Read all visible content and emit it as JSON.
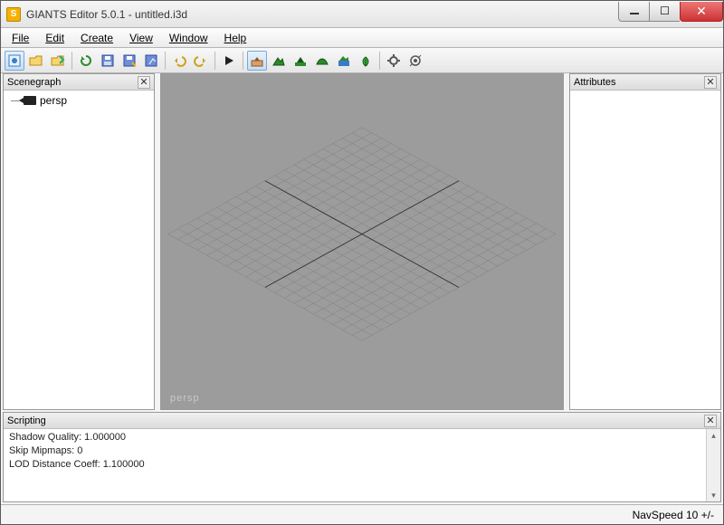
{
  "app": {
    "icon_letter": "S",
    "title": "GIANTS Editor 5.0.1 - untitled.i3d"
  },
  "menu": {
    "file": "File",
    "edit": "Edit",
    "create": "Create",
    "view": "View",
    "window": "Window",
    "help": "Help"
  },
  "panels": {
    "scenegraph": "Scenegraph",
    "attributes": "Attributes",
    "scripting": "Scripting"
  },
  "scenegraph": {
    "items": [
      {
        "label": "persp"
      }
    ]
  },
  "viewport": {
    "camera_label": "persp"
  },
  "scripting": {
    "lines": {
      "l0": "Shadow Quality: 1.000000",
      "l1": "Skip Mipmaps: 0",
      "l2": "LOD Distance Coeff: 1.100000"
    }
  },
  "status": {
    "navspeed": "NavSpeed 10 +/-"
  }
}
